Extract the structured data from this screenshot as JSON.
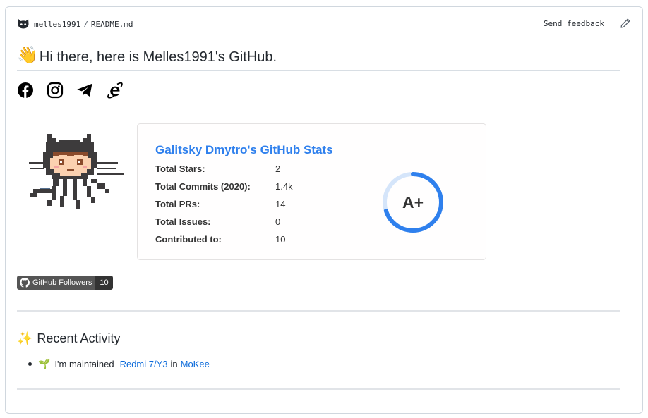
{
  "header": {
    "owner": "melles1991",
    "separator": "/",
    "file": "README.md",
    "feedback_label": "Send feedback"
  },
  "readme": {
    "wave_emoji": "👋",
    "title": "Hi there, here is Melles1991's GitHub."
  },
  "socials": [
    {
      "icon": "facebook-icon"
    },
    {
      "icon": "instagram-icon"
    },
    {
      "icon": "telegram-icon"
    },
    {
      "icon": "internet-explorer-icon"
    }
  ],
  "stats_card": {
    "title": "Galitsky Dmytro's GitHub Stats",
    "rows": [
      {
        "label": "Total Stars:",
        "value": "2"
      },
      {
        "label": "Total Commits (2020):",
        "value": "1.4k"
      },
      {
        "label": "Total PRs:",
        "value": "14"
      },
      {
        "label": "Total Issues:",
        "value": "0"
      },
      {
        "label": "Contributed to:",
        "value": "10"
      }
    ],
    "rank": "A+",
    "rank_progress": 0.7,
    "accent": "#2f80ed"
  },
  "followers_badge": {
    "label": "GitHub Followers",
    "count": "10"
  },
  "activity": {
    "icon_emoji": "✨",
    "heading": "Recent Activity",
    "item_emoji": "🌱",
    "item_prefix": "I'm maintained",
    "item_link1": "Redmi 7/Y3",
    "item_mid": "in",
    "item_link2": "MoKee"
  }
}
